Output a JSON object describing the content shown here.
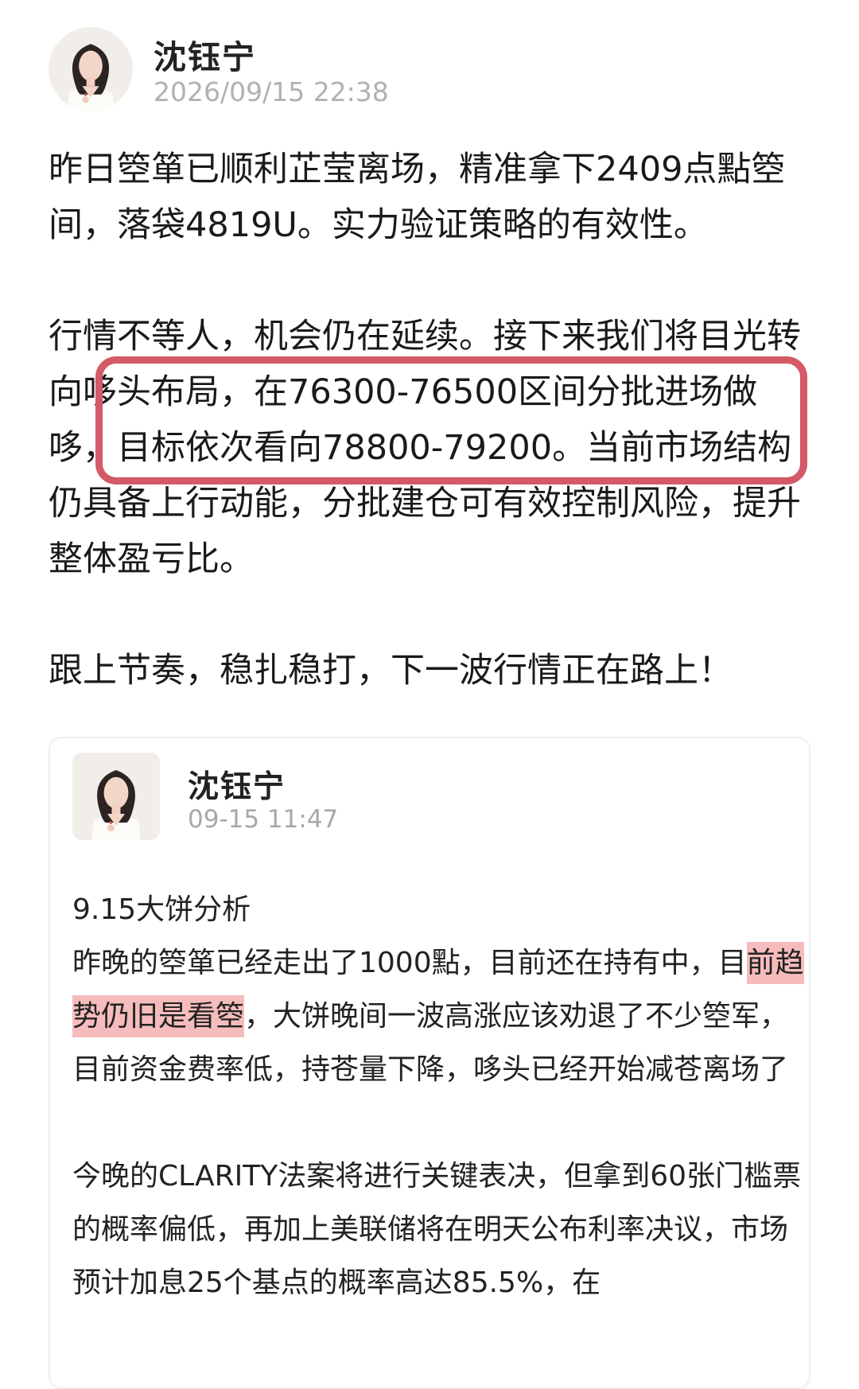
{
  "post": {
    "author": "沈钰宁",
    "time": "2026/09/15 22:38",
    "paragraphs": [
      "昨日箜箪已顺利芷莹离场，精准拿下2409点點箜间，落袋4819U。实力验证策略的有效性。",
      "行情不等人，机会仍在延续。接下来我们将目光转向哆头布局，在76300-76500区间分批进场做哆，目标依次看向78800-79200。当前市场结构仍具备上行动能，分批建仓可有效控制风险，提升整体盈亏比。",
      "跟上节奏，稳扎稳打，下一波行情正在路上！"
    ]
  },
  "quoted": {
    "author": "沈钰宁",
    "time": "09-15 11:47",
    "title": "9.15大饼分析",
    "para1_before": "昨晚的箜箪已经走出了1000點，目前还在持有中，目",
    "para1_highlight": "前趋势仍旧是看箜",
    "para1_after": "，大饼晚间一波高涨应该劝退了不少箜军，目前资金费率低，持苍量下降，哆头已经开始减苍离场了",
    "para2": "今晚的CLARITY法案将进行关键表决，但拿到60张门槛票的概率偏低，再加上美联储将在明天公布利率决议，市场预计加息25个基点的概率高达85.5%，在"
  },
  "colors": {
    "highlight_box": "#d35a66",
    "highlight_fill": "#f6bcbc",
    "time_text": "#b1b1b1"
  }
}
